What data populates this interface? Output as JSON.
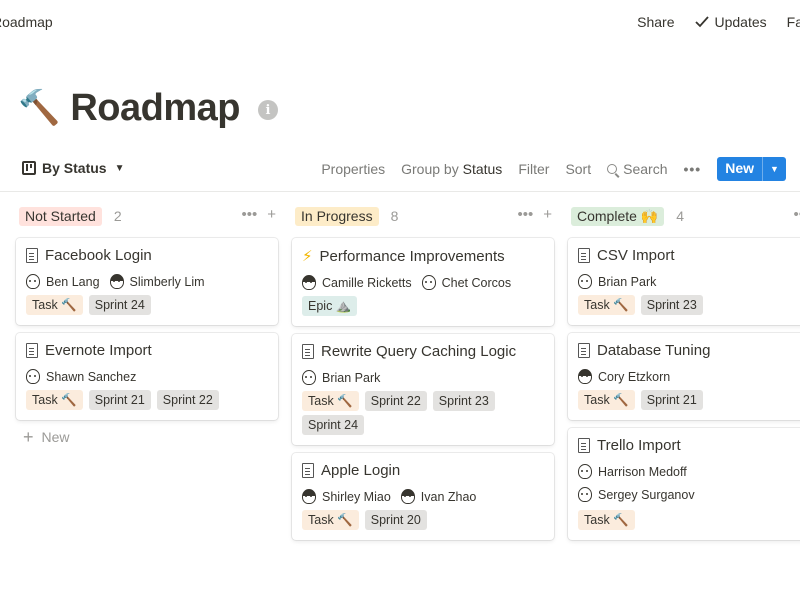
{
  "topbar": {
    "breadcrumb": "Roadmap",
    "share": "Share",
    "updates": "Updates",
    "favorite": "Fav"
  },
  "page": {
    "icon": "🔨",
    "title": "Roadmap",
    "info_icon": "i"
  },
  "view": {
    "name": "By Status",
    "properties": "Properties",
    "group_by": "Group by",
    "group_value": "Status",
    "filter": "Filter",
    "sort": "Sort",
    "search": "Search",
    "more": "•••",
    "new_button": "New"
  },
  "columns": [
    {
      "status": "Not Started",
      "count": "2",
      "color": "#ffe2dd",
      "cards": [
        {
          "title": "Facebook Login",
          "people": [
            "Ben Lang",
            "Slimberly Lim"
          ],
          "tags": [
            "Task 🔨",
            "Sprint 24"
          ]
        },
        {
          "title": "Evernote Import",
          "people": [
            "Shawn Sanchez"
          ],
          "tags": [
            "Task 🔨",
            "Sprint 21",
            "Sprint 22"
          ]
        }
      ],
      "new_label": "New"
    },
    {
      "status": "In Progress",
      "count": "8",
      "color": "#fdecc8",
      "cards": [
        {
          "title": "Performance Improvements",
          "people": [
            "Camille Ricketts",
            "Chet Corcos"
          ],
          "tags": [
            "Epic ⛰️"
          ]
        },
        {
          "title": "Rewrite Query Caching Logic",
          "people": [
            "Brian Park"
          ],
          "tags": [
            "Task 🔨",
            "Sprint 22",
            "Sprint 23",
            "Sprint 24"
          ]
        },
        {
          "title": "Apple Login",
          "people": [
            "Shirley Miao",
            "Ivan Zhao"
          ],
          "tags": [
            "Task 🔨",
            "Sprint 20"
          ]
        }
      ]
    },
    {
      "status": "Complete 🙌",
      "count": "4",
      "color": "#dbeddb",
      "cards": [
        {
          "title": "CSV Import",
          "people": [
            "Brian Park"
          ],
          "tags": [
            "Task 🔨",
            "Sprint 23"
          ]
        },
        {
          "title": "Database Tuning",
          "people": [
            "Cory Etzkorn"
          ],
          "tags": [
            "Task 🔨",
            "Sprint 21"
          ]
        },
        {
          "title": "Trello Import",
          "people": [
            "Harrison Medoff",
            "Sergey Surganov"
          ],
          "tags": [
            "Task 🔨"
          ]
        }
      ]
    }
  ]
}
